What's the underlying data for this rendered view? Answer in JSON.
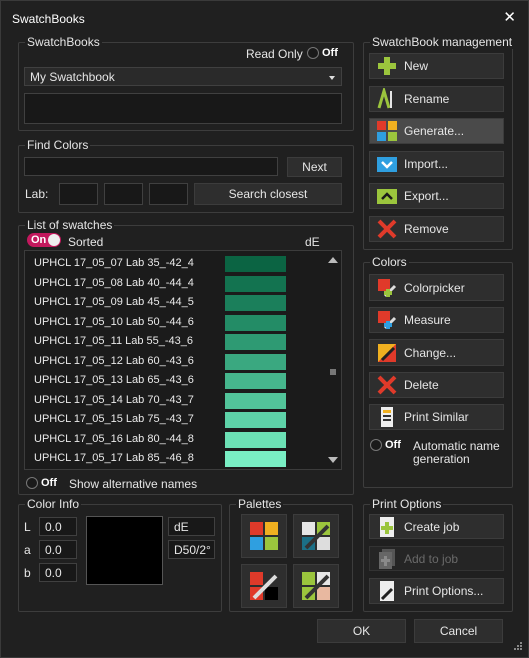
{
  "window": {
    "title": "SwatchBooks",
    "close_glyph": "✕"
  },
  "swatchbooks": {
    "group_label": "SwatchBooks",
    "read_only_label": "Read Only",
    "read_only_toggle": "Off",
    "selected_book": "My Swatchbook",
    "description": ""
  },
  "find": {
    "group_label": "Find Colors",
    "search_value": "",
    "next_label": "Next",
    "lab_label": "Lab:",
    "lab_values": [
      "",
      "",
      ""
    ],
    "search_closest_label": "Search closest"
  },
  "list": {
    "group_label": "List of swatches",
    "sorted_toggle": "On",
    "sorted_label": "Sorted",
    "de_header": "dE",
    "rows": [
      {
        "name": "UPHCL 17_05_07 Lab 35_-42_4",
        "color": "#0b6443"
      },
      {
        "name": "UPHCL 17_05_08 Lab 40_-44_4",
        "color": "#137350"
      },
      {
        "name": "UPHCL 17_05_09 Lab 45_-44_5",
        "color": "#1b7f5b"
      },
      {
        "name": "UPHCL 17_05_10 Lab 50_-44_6",
        "color": "#238c66"
      },
      {
        "name": "UPHCL 17_05_11 Lab 55_-43_6",
        "color": "#2e9a73"
      },
      {
        "name": "UPHCL 17_05_12 Lab 60_-43_6",
        "color": "#3aa880"
      },
      {
        "name": "UPHCL 17_05_13 Lab 65_-43_6",
        "color": "#46b68d"
      },
      {
        "name": "UPHCL 17_05_14 Lab 70_-43_7",
        "color": "#52c49a"
      },
      {
        "name": "UPHCL 17_05_15 Lab 75_-43_7",
        "color": "#5ed2a8"
      },
      {
        "name": "UPHCL 17_05_16 Lab 80_-44_8",
        "color": "#6ce0b5"
      },
      {
        "name": "UPHCL 17_05_17 Lab 85_-46_8",
        "color": "#79eec4"
      }
    ],
    "alt_names_toggle": "Off",
    "alt_names_label": "Show alternative names"
  },
  "management": {
    "group_label": "SwatchBook management",
    "new_label": "New",
    "rename_label": "Rename",
    "generate_label": "Generate...",
    "import_label": "Import...",
    "export_label": "Export...",
    "remove_label": "Remove"
  },
  "colors": {
    "group_label": "Colors",
    "colorpicker_label": "Colorpicker",
    "measure_label": "Measure",
    "change_label": "Change...",
    "delete_label": "Delete",
    "print_similar_label": "Print Similar",
    "auto_name_toggle": "Off",
    "auto_name_label_1": "Automatic name",
    "auto_name_label_2": "generation"
  },
  "color_info": {
    "group_label": "Color Info",
    "l_label": "L",
    "l_value": "0.0",
    "a_label": "a",
    "a_value": "0.0",
    "b_label": "b",
    "b_value": "0.0",
    "preview_color": "#000000",
    "de_label": "dE",
    "illuminant": "D50/2°"
  },
  "palettes": {
    "group_label": "Palettes"
  },
  "print_options": {
    "group_label": "Print Options",
    "create_job_label": "Create job",
    "add_to_job_label": "Add to job",
    "print_options_label": "Print Options..."
  },
  "footer": {
    "ok_label": "OK",
    "cancel_label": "Cancel"
  },
  "colors_theme": {
    "accent_on": "#c3185d",
    "green_icon": "#9bc53d",
    "red_icon": "#e03a2a",
    "blue_icon": "#2f9fe0"
  }
}
